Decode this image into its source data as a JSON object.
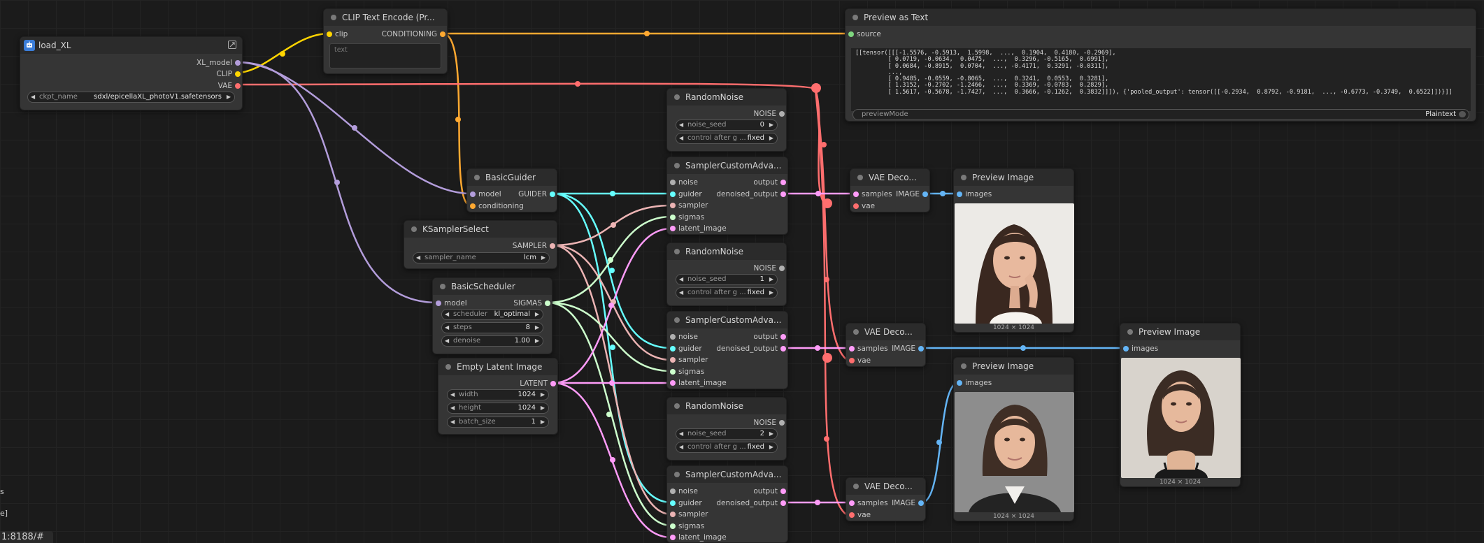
{
  "colors": {
    "model": "#b39ddb",
    "clip": "#ffd500",
    "conditioning": "#ffa931",
    "vae": "#ff6e6e",
    "guider": "#66ffff",
    "sampler": "#ecb4b4",
    "sigmas": "#cdffcd",
    "latent": "#ff9cf9",
    "noise": "#b0b0b0",
    "image": "#64b5f6",
    "source_green": "#7fd67f"
  },
  "load_xl": {
    "title": "load_XL",
    "icon": "bot-icon",
    "outputs": [
      "XL_model",
      "CLIP",
      "VAE"
    ],
    "widget": {
      "name": "ckpt_name",
      "value": "sdxl/epicellaXL_photoV1.safetensors"
    }
  },
  "clip_encode": {
    "title": "CLIP Text Encode (Pr...",
    "input": "clip",
    "output": "CONDITIONING",
    "placeholder": "text"
  },
  "preview_text": {
    "title": "Preview as Text",
    "input": "source",
    "content": "[[tensor([[[-1.5576, -0.5913,  1.5998,  ...,  0.1904,  0.4180, -0.2969],\n         [ 0.0719, -0.0634,  0.0475,  ...,  0.3296, -0.5165,  0.6991],\n         [ 0.0684, -0.8915,  0.0704,  ..., -0.4171,  0.3291, -0.0311],\n         ...,\n         [ 0.9485, -0.0559, -0.8065,  ...,  0.3241,  0.0553,  0.3281],\n         [ 1.3152, -0.2702, -1.2466,  ...,  0.3369, -0.0783,  0.2829],\n         [ 1.5617, -0.5678, -1.7427,  ...,  0.3666, -0.1262,  0.3832]]]), {'pooled_output': tensor([[-0.2934,  0.8792, -0.9181,  ..., -0.6773, -0.3749,  0.6522]])}]]",
    "widget": {
      "name": "previewMode",
      "value": "Plaintext"
    }
  },
  "basic_guider": {
    "title": "BasicGuider",
    "inputs": [
      "model",
      "conditioning"
    ],
    "output": "GUIDER"
  },
  "ksampler_select": {
    "title": "KSamplerSelect",
    "output": "SAMPLER",
    "widget": {
      "name": "sampler_name",
      "value": "lcm"
    }
  },
  "basic_scheduler": {
    "title": "BasicScheduler",
    "input": "model",
    "output": "SIGMAS",
    "widgets": [
      {
        "name": "scheduler",
        "value": "kl_optimal"
      },
      {
        "name": "steps",
        "value": "8"
      },
      {
        "name": "denoise",
        "value": "1.00"
      }
    ]
  },
  "empty_latent": {
    "title": "Empty Latent Image",
    "output": "LATENT",
    "widgets": [
      {
        "name": "width",
        "value": "1024"
      },
      {
        "name": "height",
        "value": "1024"
      },
      {
        "name": "batch_size",
        "value": "1"
      }
    ]
  },
  "random_noise": [
    {
      "title": "RandomNoise",
      "output": "NOISE",
      "seed_name": "noise_seed",
      "seed": "0",
      "ctrl_name": "control after g ...",
      "ctrl": "fixed"
    },
    {
      "title": "RandomNoise",
      "output": "NOISE",
      "seed_name": "noise_seed",
      "seed": "1",
      "ctrl_name": "control after g ...",
      "ctrl": "fixed"
    },
    {
      "title": "RandomNoise",
      "output": "NOISE",
      "seed_name": "noise_seed",
      "seed": "2",
      "ctrl_name": "control after g ...",
      "ctrl": "fixed"
    }
  ],
  "sampler_custom": {
    "title": "SamplerCustomAdva...",
    "inputs": [
      "noise",
      "guider",
      "sampler",
      "sigmas",
      "latent_image"
    ],
    "outputs": [
      "output",
      "denoised_output"
    ]
  },
  "vae_decode": {
    "title": "VAE Deco...",
    "inputs": [
      "samples",
      "vae"
    ],
    "output": "IMAGE"
  },
  "preview_image": {
    "title": "Preview Image",
    "input": "images",
    "caption": "1024 × 1024"
  },
  "left_edge": {
    "fragment_1": "s",
    "fragment_2": "e]",
    "url_fragment": "1:8188/#"
  }
}
